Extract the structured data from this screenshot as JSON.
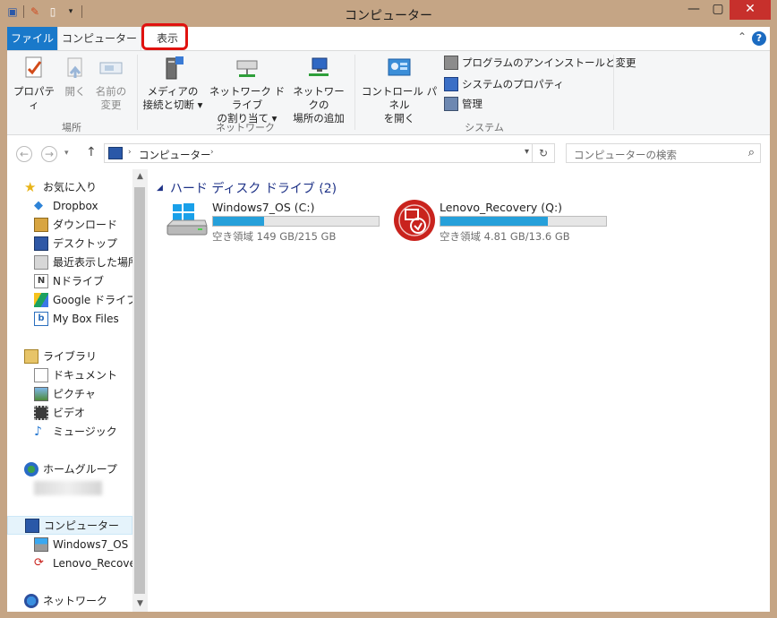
{
  "window": {
    "title": "コンピューター"
  },
  "tabs": {
    "file": "ファイル",
    "computer": "コンピューター",
    "view": "表示"
  },
  "ribbon": {
    "properties": "プロパティ",
    "open": "開く",
    "rename": "名前の\n変更",
    "group_location": "場所",
    "media": "メディアの\n接続と切断 ▾",
    "map_drive": "ネットワーク ドライブ\nの割り当て ▾",
    "add_location": "ネットワークの\n場所の追加",
    "group_network": "ネットワーク",
    "control_panel": "コントロール パネル\nを開く",
    "uninstall": "プログラムのアンインストールと変更",
    "sys_props": "システムのプロパティ",
    "manage": "管理",
    "group_system": "システム"
  },
  "address": {
    "path": "コンピューター",
    "search_placeholder": "コンピューターの検索"
  },
  "nav": {
    "favorites": "お気に入り",
    "dropbox": "Dropbox",
    "downloads": "ダウンロード",
    "desktop": "デスクトップ",
    "recent": "最近表示した場所",
    "ndrive": "Nドライブ",
    "gdrive": "Google ドライブ",
    "mybox": "My Box Files",
    "libraries": "ライブラリ",
    "documents": "ドキュメント",
    "pictures": "ピクチャ",
    "videos": "ビデオ",
    "music": "ミュージック",
    "homegroup": "ホームグループ",
    "computer": "コンピューター",
    "drive_c": "Windows7_OS (",
    "drive_q": "Lenovo_Recove",
    "network": "ネットワーク"
  },
  "main": {
    "group_title": "ハード ディスク ドライブ (2)",
    "drives": [
      {
        "name": "Windows7_OS (C:)",
        "info": "空き領域 149 GB/215 GB",
        "used_fraction": 0.31
      },
      {
        "name": "Lenovo_Recovery (Q:)",
        "info": "空き領域 4.81 GB/13.6 GB",
        "used_fraction": 0.65
      }
    ]
  },
  "colors": {
    "accent": "#1979ca",
    "bar_fill": "#26a0da",
    "highlight": "#e0120f",
    "frame": "#c5a585"
  }
}
